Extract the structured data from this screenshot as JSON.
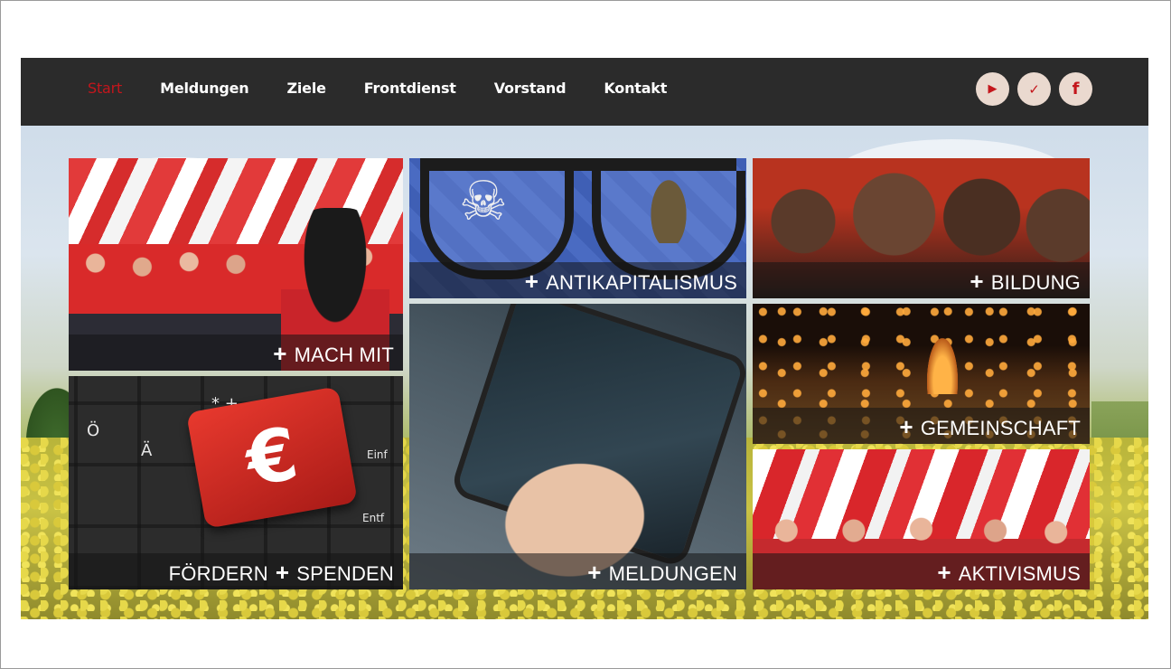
{
  "nav": {
    "items": [
      {
        "label": "Start",
        "active": true
      },
      {
        "label": "Meldungen",
        "active": false
      },
      {
        "label": "Ziele",
        "active": false
      },
      {
        "label": "Frontdienst",
        "active": false
      },
      {
        "label": "Vorstand",
        "active": false
      },
      {
        "label": "Kontakt",
        "active": false
      }
    ],
    "active_color": "#c4161c"
  },
  "social": [
    {
      "icon": "youtube-icon",
      "glyph": "▶"
    },
    {
      "icon": "twitter-icon",
      "glyph": "✓"
    },
    {
      "icon": "facebook-icon",
      "glyph": "f"
    }
  ],
  "tiles": {
    "machmit": {
      "label": "MACH MIT"
    },
    "antikapitalismus": {
      "label": "ANTIKAPITALISMUS",
      "bg_text": "ANTIKAPITALISMUS"
    },
    "bildung": {
      "label": "BILDUNG"
    },
    "gemeinschaft": {
      "label": "GEMEINSCHAFT"
    },
    "foerdern": {
      "label_left": "FÖRDERN",
      "label_right": "SPENDEN"
    },
    "meldungen": {
      "label": "MELDUNGEN"
    },
    "aktivismus": {
      "label": "AKTIVISMUS"
    }
  },
  "plus_glyph": "+"
}
